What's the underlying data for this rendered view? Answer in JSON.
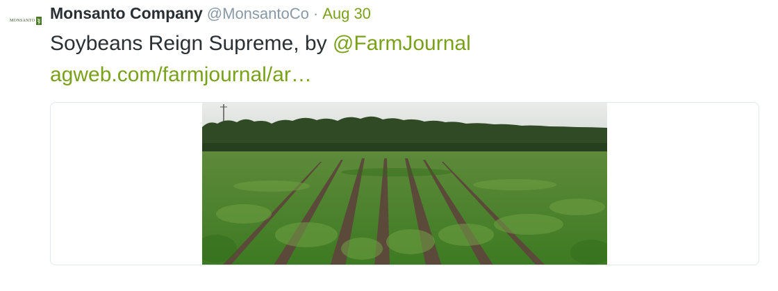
{
  "tweet": {
    "avatar_text": "MONSANTO",
    "author_name": "Monsanto Company",
    "author_handle": "@MonsantoCo",
    "separator": "·",
    "timestamp": "Aug 30",
    "text_prefix": "Soybeans Reign Supreme, by ",
    "mention": "@FarmJournal",
    "link_text": "agweb.com/farmjournal/ar…"
  },
  "colors": {
    "accent": "#79a11a",
    "text": "#292f33",
    "muted": "#8899a6",
    "card_border": "#e1e8ed"
  },
  "icons": {
    "avatar": "monsanto-logo-icon",
    "card_image": "soybean-field-photo"
  }
}
